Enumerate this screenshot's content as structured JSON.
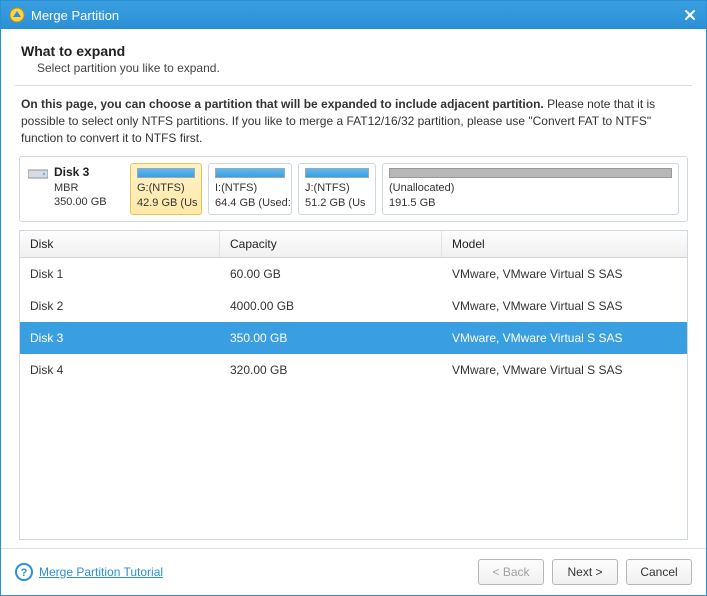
{
  "window": {
    "title": "Merge Partition"
  },
  "header": {
    "heading": "What to expand",
    "sub": "Select partition you like to expand."
  },
  "description": {
    "bold": "On this page, you can choose a partition that will be expanded to include adjacent partition.",
    "rest": " Please note that it is possible to select only NTFS partitions. If you like to merge a FAT12/16/32 partition, please use \"Convert FAT to NTFS\" function to convert it to NTFS first."
  },
  "disk_summary": {
    "name": "Disk 3",
    "type": "MBR",
    "size": "350.00 GB"
  },
  "partitions": {
    "g": {
      "label": "G:(NTFS)",
      "size": "42.9 GB (Us"
    },
    "i": {
      "label": "I:(NTFS)",
      "size": "64.4 GB (Used:"
    },
    "j": {
      "label": "J:(NTFS)",
      "size": "51.2 GB (Us"
    },
    "u": {
      "label": "(Unallocated)",
      "size": "191.5 GB"
    }
  },
  "table": {
    "headers": {
      "disk": "Disk",
      "capacity": "Capacity",
      "model": "Model"
    },
    "rows": [
      {
        "disk": "Disk 1",
        "capacity": "60.00 GB",
        "model": "VMware, VMware Virtual S SAS"
      },
      {
        "disk": "Disk 2",
        "capacity": "4000.00 GB",
        "model": "VMware, VMware Virtual S SAS"
      },
      {
        "disk": "Disk 3",
        "capacity": "350.00 GB",
        "model": "VMware, VMware Virtual S SAS"
      },
      {
        "disk": "Disk 4",
        "capacity": "320.00 GB",
        "model": "VMware, VMware Virtual S SAS"
      }
    ],
    "selected_index": 2
  },
  "footer": {
    "tutorial": "Merge Partition Tutorial",
    "back": "< Back",
    "next": "Next >",
    "cancel": "Cancel"
  }
}
